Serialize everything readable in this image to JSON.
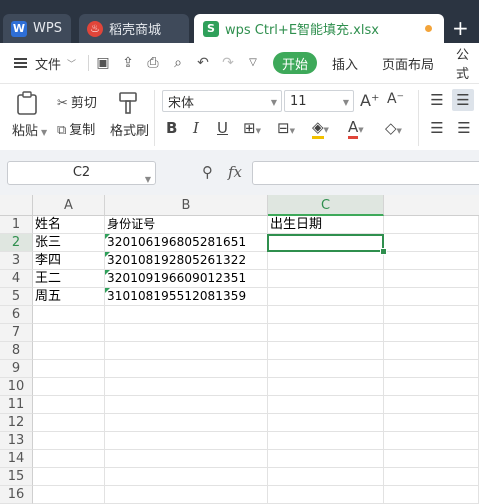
{
  "tabs": [
    {
      "label": "WPS",
      "icon": "wps-logo-icon"
    },
    {
      "label": "稻壳商城",
      "icon": "docer-flame-icon"
    },
    {
      "label": "wps Ctrl+E智能填充.xlsx",
      "icon": "spreadsheet-file-icon"
    }
  ],
  "menu": {
    "file": "文件",
    "start": "开始",
    "insert": "插入",
    "page_layout": "页面布局",
    "formula": "公式"
  },
  "ribbon": {
    "paste": "粘贴",
    "cut": "剪切",
    "copy": "复制",
    "format_painter": "格式刷",
    "font_name": "宋体",
    "font_size": "11"
  },
  "formula_bar": {
    "name_box": "C2",
    "fx": "fx",
    "value": ""
  },
  "sheet": {
    "columns": [
      "A",
      "B",
      "C"
    ],
    "rows": [
      "1",
      "2",
      "3",
      "4",
      "5",
      "6",
      "7",
      "8",
      "9",
      "10",
      "11",
      "12",
      "13",
      "14",
      "15",
      "16"
    ],
    "active_cell": "C2",
    "cells": [
      [
        "姓名",
        "身份证号",
        "出生日期"
      ],
      [
        "张三",
        "320106196805281651",
        ""
      ],
      [
        "李四",
        "320108192805261322",
        ""
      ],
      [
        "王二",
        "320109196609012351",
        ""
      ],
      [
        "周五",
        "310108195512081359",
        ""
      ]
    ]
  },
  "colors": {
    "accent": "#3ea95a",
    "tabbar": "#2b3441"
  }
}
